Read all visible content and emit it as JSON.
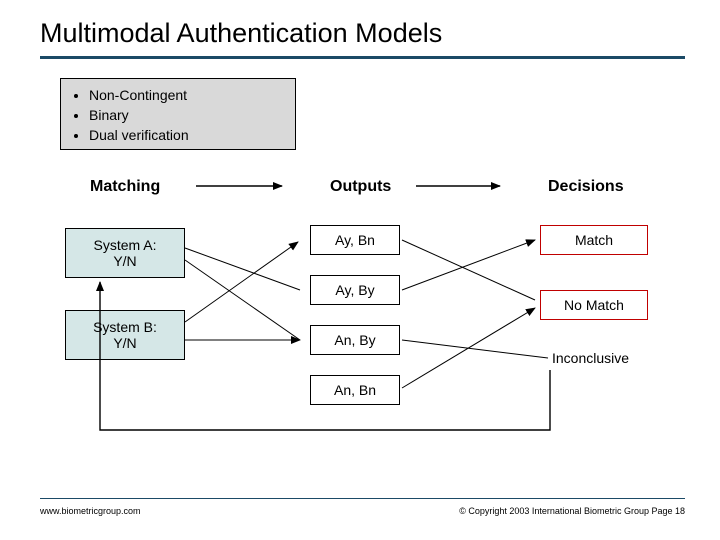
{
  "title": "Multimodal Authentication Models",
  "types": {
    "items": [
      "Non-Contingent",
      "Binary",
      "Dual verification"
    ]
  },
  "columns": {
    "matching": "Matching",
    "outputs": "Outputs",
    "decisions": "Decisions"
  },
  "systems": {
    "a": "System A:\nY/N",
    "b": "System B:\nY/N"
  },
  "outputs": {
    "o1": "Ay, Bn",
    "o2": "Ay, By",
    "o3": "An, By",
    "o4": "An, Bn"
  },
  "decisions": {
    "match": "Match",
    "nomatch": "No Match",
    "inconclusive": "Inconclusive"
  },
  "footer": {
    "url": "www.biometricgroup.com",
    "copyright": "© Copyright 2003 International Biometric Group  Page 18"
  }
}
